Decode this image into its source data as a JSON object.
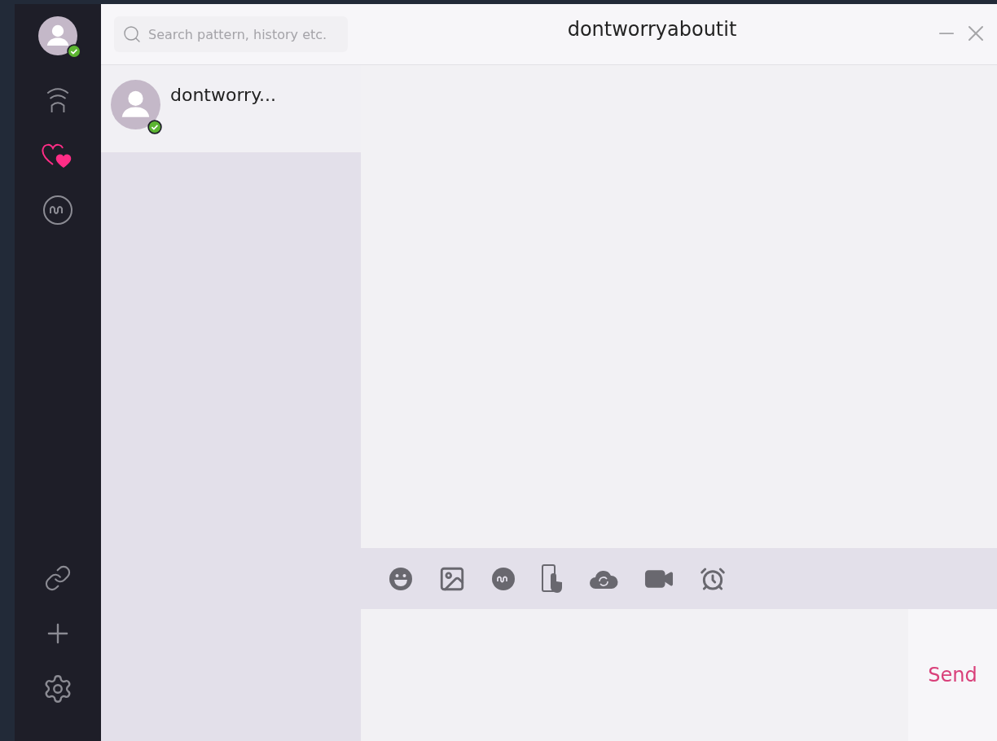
{
  "account": {
    "online": true
  },
  "sidebar": {
    "items": [
      {
        "kind": "signal",
        "selected": false
      },
      {
        "kind": "hearts",
        "selected": true
      },
      {
        "kind": "wave",
        "selected": false
      },
      {
        "kind": "link",
        "selected": false
      },
      {
        "kind": "add",
        "selected": false
      },
      {
        "kind": "settings",
        "selected": false
      }
    ]
  },
  "search": {
    "placeholder": "Search pattern, history etc."
  },
  "contacts": [
    {
      "name": "dontworry...",
      "online": true,
      "selected": true
    }
  ],
  "chat": {
    "title": "dontworryaboutit"
  },
  "toolbar": [
    {
      "kind": "emoji"
    },
    {
      "kind": "image"
    },
    {
      "kind": "wave"
    },
    {
      "kind": "phone"
    },
    {
      "kind": "cloud"
    },
    {
      "kind": "video"
    },
    {
      "kind": "alarm"
    }
  ],
  "composer": {
    "send": "Send"
  }
}
